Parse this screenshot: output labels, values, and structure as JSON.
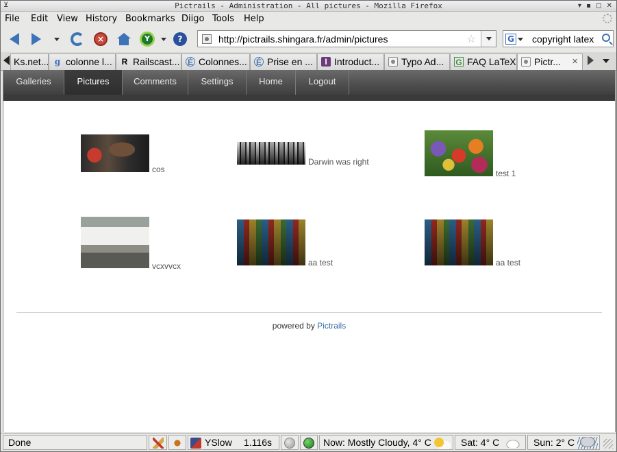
{
  "window": {
    "title": "Pictrails - Administration - All pictures - Mozilla Firefox"
  },
  "menu": [
    {
      "key": "F",
      "rest": "ile"
    },
    {
      "key": "E",
      "rest": "dit"
    },
    {
      "key": "V",
      "rest": "iew"
    },
    {
      "key": "",
      "rest": "Hi",
      "key2": "s",
      "rest2": "tory"
    },
    {
      "key": "B",
      "rest": "ookmarks"
    },
    {
      "key": "",
      "rest": "Diigo"
    },
    {
      "key": "T",
      "rest": "ools"
    },
    {
      "key": "H",
      "rest": "elp"
    }
  ],
  "menu_labels": {
    "file": "File",
    "edit": "Edit",
    "view": "View",
    "history": "History",
    "bookmarks": "Bookmarks",
    "diigo": "Diigo",
    "tools": "Tools",
    "help": "Help"
  },
  "navigation": {
    "url": "http://pictrails.shingara.fr/admin/pictures",
    "search_value": "copyright latex",
    "search_engine_letter": "G",
    "y_icon_letter": "Y",
    "q_icon_letter": "?",
    "stop_icon_letter": "×"
  },
  "tabs": [
    {
      "label": "Ks.net...",
      "icon": "doc-icon"
    },
    {
      "label": "colonne l...",
      "icon": "google-icon",
      "icon_text": "g"
    },
    {
      "label": "Railscast...",
      "icon": "railscasts-icon",
      "icon_text": "R"
    },
    {
      "label": "Colonnes...",
      "icon": "e-icon",
      "icon_text": "É"
    },
    {
      "label": "Prise en ...",
      "icon": "e-icon",
      "icon_text": "É"
    },
    {
      "label": "Introduct...",
      "icon": "intro-icon",
      "icon_text": "I"
    },
    {
      "label": "Typo Ad...",
      "icon": "doc-icon"
    },
    {
      "label": "FAQ LaTeX",
      "icon": "faq-icon",
      "icon_text": "G"
    },
    {
      "label": "Pictr...",
      "icon": "doc-icon",
      "active": true
    }
  ],
  "tab_close_glyph": "×",
  "site_nav": [
    {
      "label": "Galleries"
    },
    {
      "label": "Pictures",
      "active": true
    },
    {
      "label": "Comments"
    },
    {
      "label": "Settings"
    },
    {
      "label": "Home"
    },
    {
      "label": "Logout"
    }
  ],
  "pictures": [
    {
      "caption": "cos"
    },
    {
      "caption": "Darwin was right"
    },
    {
      "caption": "test 1"
    },
    {
      "caption": "vcxvvcx"
    },
    {
      "caption": "aa test"
    },
    {
      "caption": "aa test"
    }
  ],
  "footer": {
    "prefix": "powered by",
    "link": "Pictrails"
  },
  "status": {
    "text": "Done",
    "yslow_label": "YSlow",
    "yslow_time": "1.116s",
    "weather_now": "Now: Mostly Cloudy, 4° C",
    "weather_sat": "Sat: 4° C",
    "weather_sun": "Sun: 2° C"
  },
  "colors": {
    "nav_gradient_top": "#6a6a6a",
    "nav_active": "#333333",
    "link": "#3a6ea5",
    "caption": "#555555"
  }
}
